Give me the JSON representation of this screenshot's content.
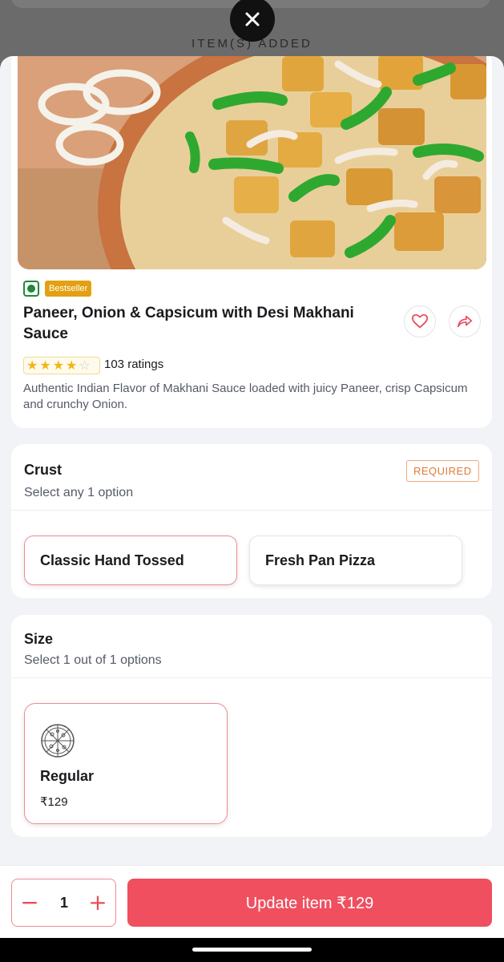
{
  "overlay": {
    "added_text": "ITEM(S) ADDED",
    "close_icon": "close-icon"
  },
  "item": {
    "badge": "Bestseller",
    "title": "Paneer, Onion & Capsicum with Desi Makhani Sauce",
    "rating_stars": 4,
    "ratings_text": "103 ratings",
    "description": "Authentic Indian Flavor of Makhani Sauce loaded with juicy Paneer, crisp Capsicum and crunchy Onion.",
    "icons": [
      "veg-icon",
      "heart-icon",
      "share-icon"
    ]
  },
  "crust": {
    "title": "Crust",
    "subtitle": "Select any 1 option",
    "required": "REQUIRED",
    "options": [
      {
        "label": "Classic Hand Tossed",
        "selected": true
      },
      {
        "label": "Fresh Pan Pizza",
        "selected": false
      }
    ]
  },
  "size": {
    "title": "Size",
    "subtitle": "Select 1 out of 1 options",
    "options": [
      {
        "label": "Regular",
        "price": "₹129",
        "icon": "pizza-icon",
        "selected": true
      }
    ]
  },
  "footer": {
    "quantity": "1",
    "minus": "−",
    "plus": "+",
    "update_label": "Update item ₹129"
  },
  "colors": {
    "accent": "#ef4f5f",
    "veg": "#1e8a3a",
    "bestseller": "#e2a012",
    "required": "#e0793a"
  }
}
